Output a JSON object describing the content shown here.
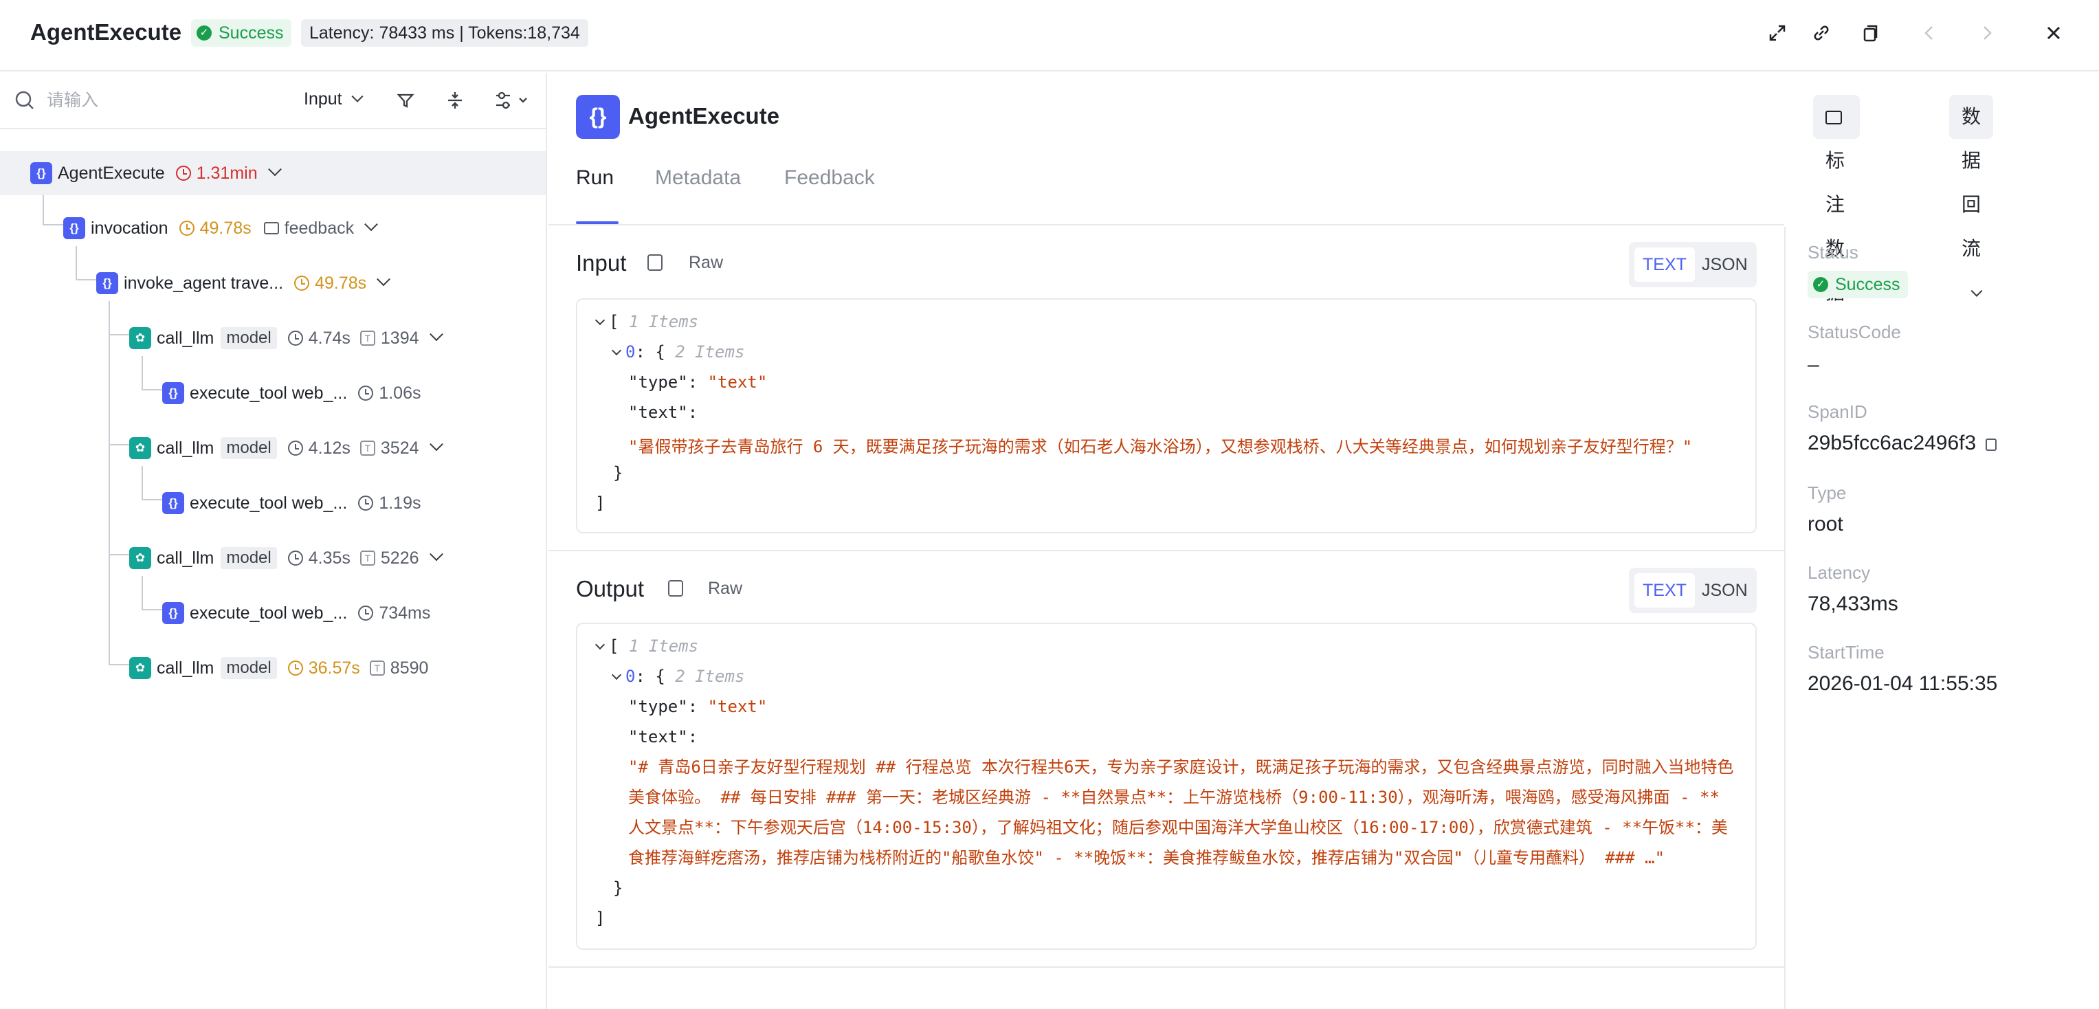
{
  "header": {
    "title": "AgentExecute",
    "status": "Success",
    "latency_tokens": "Latency: 78433 ms | Tokens:18,734",
    "icons": [
      "expand-icon",
      "link-icon",
      "copy-icon",
      "prev-icon",
      "next-icon",
      "close-icon"
    ]
  },
  "left": {
    "search_placeholder": "请输入",
    "select_value": "Input",
    "tree": [
      {
        "name": "AgentExecute",
        "time": "1.31min",
        "time_color": "#d43030",
        "kind": "chain"
      },
      {
        "name": "invocation",
        "time": "49.78s",
        "extra": "feedback",
        "kind": "chain"
      },
      {
        "name": "invoke_agent trave...",
        "time": "49.78s",
        "kind": "chain"
      },
      {
        "name": "call_llm",
        "tag": "model",
        "time": "4.74s",
        "tokens": "1394",
        "kind": "llm"
      },
      {
        "name": "execute_tool web_...",
        "time": "1.06s",
        "kind": "chain"
      },
      {
        "name": "call_llm",
        "tag": "model",
        "time": "4.12s",
        "tokens": "3524",
        "kind": "llm"
      },
      {
        "name": "execute_tool web_...",
        "time": "1.19s",
        "kind": "chain"
      },
      {
        "name": "call_llm",
        "tag": "model",
        "time": "4.35s",
        "tokens": "5226",
        "kind": "llm"
      },
      {
        "name": "execute_tool web_...",
        "time": "734ms",
        "kind": "chain"
      },
      {
        "name": "call_llm",
        "tag": "model",
        "time": "36.57s",
        "tokens": "8590",
        "kind": "llm"
      }
    ]
  },
  "main": {
    "title": "AgentExecute",
    "buttons": {
      "annotate": "标注数据",
      "reflow": "数据回流"
    },
    "tabs": [
      "Run",
      "Metadata",
      "Feedback"
    ],
    "active_tab": "Run",
    "input": {
      "label": "Input",
      "raw": "Raw",
      "text_btn": "TEXT",
      "json_btn": "JSON",
      "items_count": "1 Items",
      "obj_count": "2 Items",
      "type_key": "\"type\"",
      "type_val": "\"text\"",
      "text_key": "\"text\"",
      "text_val": "\"暑假带孩子去青岛旅行 6 天，既要满足孩子玩海的需求（如石老人海水浴场），又想参观栈桥、八大关等经典景点，如何规划亲子友好型行程？\""
    },
    "output": {
      "label": "Output",
      "raw": "Raw",
      "text_btn": "TEXT",
      "json_btn": "JSON",
      "items_count": "1 Items",
      "obj_count": "2 Items",
      "type_key": "\"type\"",
      "type_val": "\"text\"",
      "text_key": "\"text\"",
      "text_val": "\"# 青岛6日亲子友好型行程规划 ## 行程总览 本次行程共6天，专为亲子家庭设计，既满足孩子玩海的需求，又包含经典景点游览，同时融入当地特色美食体验。 ## 每日安排 ### 第一天：老城区经典游 - **自然景点**：上午游览栈桥（9:00-11:30），观海听涛，喂海鸥，感受海风拂面 - **人文景点**：下午参观天后宫（14:00-15:30），了解妈祖文化；随后参观中国海洋大学鱼山校区（16:00-17:00），欣赏德式建筑 - **午饭**：美食推荐海鲜疙瘩汤，推荐店铺为栈桥附近的\"船歌鱼水饺\" - **晚饭**：美食推荐鲅鱼水饺，推荐店铺为\"双合园\"（儿童专用蘸料） ### …\""
    }
  },
  "details": {
    "status_label": "Status",
    "status": "Success",
    "statuscode_label": "StatusCode",
    "statuscode": "–",
    "spanid_label": "SpanID",
    "spanid": "29b5fcc6ac2496f3",
    "type_label": "Type",
    "type": "root",
    "latency_label": "Latency",
    "latency": "78,433ms",
    "start_label": "StartTime",
    "start": "2026-01-04 11:55:35"
  }
}
